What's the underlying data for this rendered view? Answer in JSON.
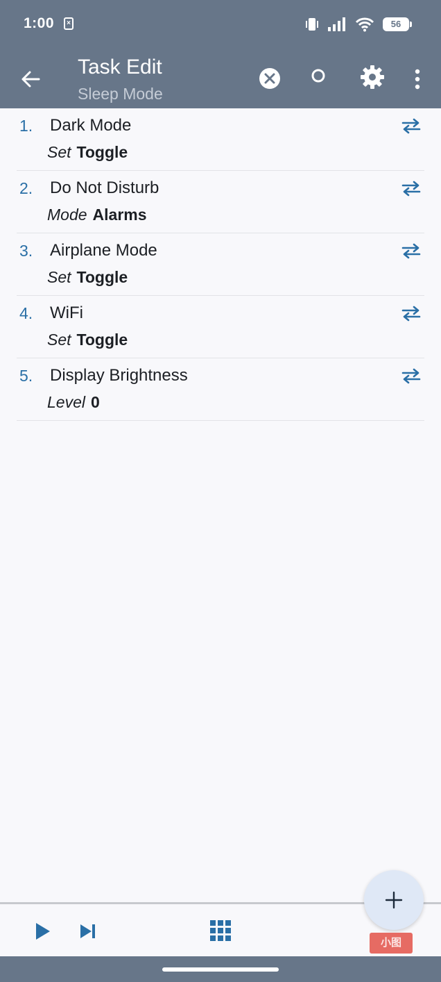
{
  "status_bar": {
    "time": "1:00",
    "notification_icon": "x-notification-icon",
    "icons": [
      "vibrate-icon",
      "signal-icon",
      "wifi-icon"
    ],
    "battery": "56"
  },
  "app_bar": {
    "title": "Task Edit",
    "subtitle": "Sleep Mode",
    "icons": [
      "back-arrow-icon",
      "cancel-icon",
      "record-icon",
      "gear-icon",
      "more-vert-icon"
    ]
  },
  "actions": [
    {
      "number": "1.",
      "name": "Dark Mode",
      "param_label": "Set",
      "param_value": "Toggle"
    },
    {
      "number": "2.",
      "name": "Do Not Disturb",
      "param_label": "Mode",
      "param_value": "Alarms"
    },
    {
      "number": "3.",
      "name": "Airplane Mode",
      "param_label": "Set",
      "param_value": "Toggle"
    },
    {
      "number": "4.",
      "name": "WiFi",
      "param_label": "Set",
      "param_value": "Toggle"
    },
    {
      "number": "5.",
      "name": "Display Brightness",
      "param_label": "Level",
      "param_value": "0"
    }
  ],
  "bottom_bar": {
    "icons": [
      "play-icon",
      "skip-next-icon",
      "grid-icon",
      "add-icon"
    ],
    "badge": "小图"
  },
  "colors": {
    "header": "#677689",
    "accent": "#2a6fa6",
    "background": "#f8f8fb",
    "fab": "#dfe8f6"
  }
}
